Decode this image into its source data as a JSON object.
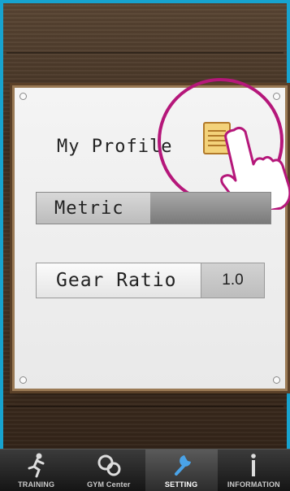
{
  "profile": {
    "title": "My Profile",
    "icon": "notepad-icon"
  },
  "settings": {
    "metric_label": "Metric",
    "gear_ratio_label": "Gear Ratio",
    "gear_ratio_value": "1.0"
  },
  "tabs": [
    {
      "label": "TRAINING",
      "icon": "runner-icon",
      "active": false
    },
    {
      "label": "GYM Center",
      "icon": "gym-center-icon",
      "active": false
    },
    {
      "label": "SETTING",
      "icon": "wrench-icon",
      "active": true
    },
    {
      "label": "INFORMATION",
      "icon": "info-icon",
      "active": false
    }
  ],
  "colors": {
    "frame_border": "#17a3cf",
    "highlight": "#b5177a"
  }
}
